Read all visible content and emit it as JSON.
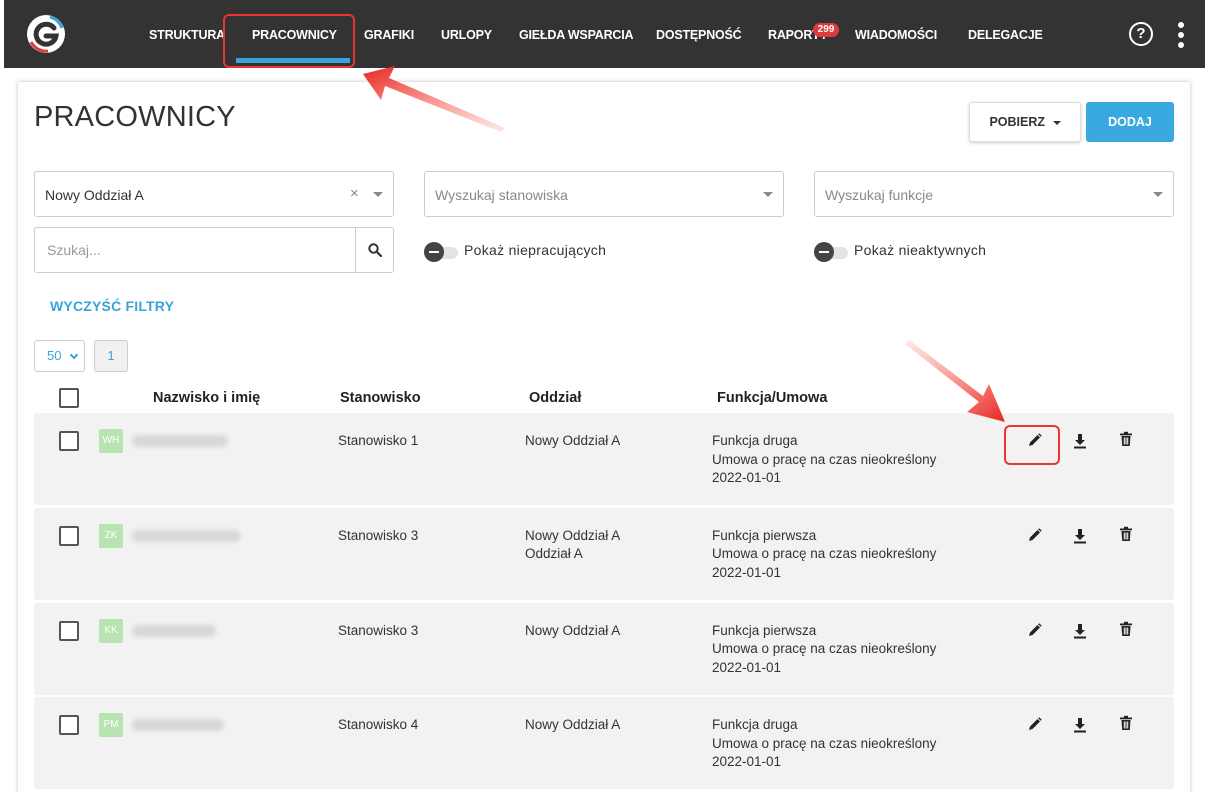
{
  "nav": {
    "items": [
      "STRUKTURA",
      "PRACOWNICY",
      "GRAFIKI",
      "URLOPY",
      "GIEŁDA WSPARCIA",
      "DOSTĘPNOŚĆ",
      "RAPORTY",
      "WIADOMOŚCI",
      "DELEGACJE"
    ],
    "active": "PRACOWNICY",
    "reports_badge": "299",
    "help_label": "?"
  },
  "page": {
    "title": "PRACOWNICY",
    "download_label": "POBIERZ",
    "add_label": "DODAJ"
  },
  "filters": {
    "department_value": "Nowy Oddział A",
    "position_placeholder": "Wyszukaj stanowiska",
    "function_placeholder": "Wyszukaj funkcje",
    "search_placeholder": "Szukaj...",
    "toggle_not_working": "Pokaż niepracujących",
    "toggle_inactive": "Pokaż nieaktywnych",
    "clear_label": "WYCZYŚĆ FILTRY"
  },
  "pagination": {
    "page_size": "50",
    "current_page": "1"
  },
  "table": {
    "headers": [
      "Nazwisko i imię",
      "Stanowisko",
      "Oddział",
      "Funkcja/Umowa"
    ],
    "rows": [
      {
        "initials": "WH",
        "position": "Stanowisko 1",
        "departments": [
          "Nowy Oddział A"
        ],
        "function": "Funkcja druga",
        "contract": "Umowa o pracę na czas nieokreślony",
        "date": "2022-01-01"
      },
      {
        "initials": "ZK",
        "position": "Stanowisko 3",
        "departments": [
          "Nowy Oddział A",
          "Oddział A"
        ],
        "function": "Funkcja pierwsza",
        "contract": "Umowa o pracę na czas nieokreślony",
        "date": "2022-01-01"
      },
      {
        "initials": "KK",
        "position": "Stanowisko 3",
        "departments": [
          "Nowy Oddział A"
        ],
        "function": "Funkcja pierwsza",
        "contract": "Umowa o pracę na czas nieokreślony",
        "date": "2022-01-01"
      },
      {
        "initials": "PM",
        "position": "Stanowisko 4",
        "departments": [
          "Nowy Oddział A"
        ],
        "function": "Funkcja druga",
        "contract": "Umowa o pracę na czas nieokreślony",
        "date": "2022-01-01"
      }
    ]
  },
  "colors": {
    "accent": "#3aa3dc",
    "topbar": "#333333",
    "annotation": "#e33333",
    "avatar": "#b7e4b0"
  }
}
